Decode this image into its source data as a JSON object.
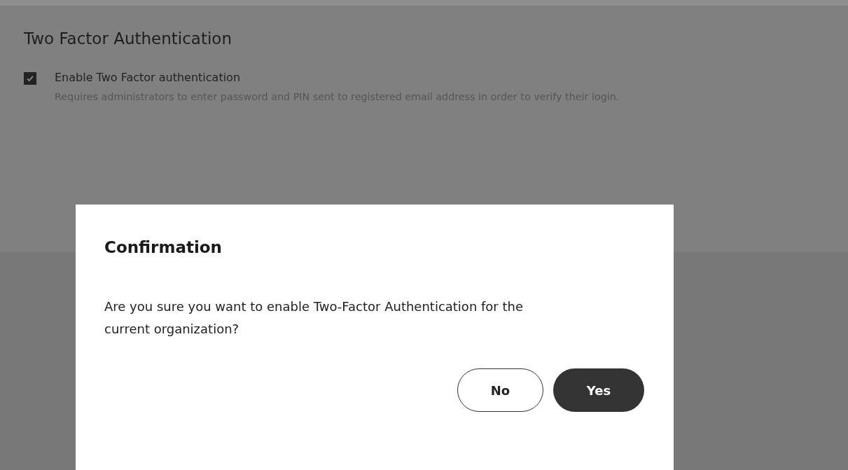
{
  "page": {
    "title": "Two Factor Authentication",
    "option": {
      "label": "Enable Two Factor authentication",
      "checked": true,
      "description": "Requires administrators to enter password and PIN sent to registered email address in order to verify their login."
    }
  },
  "dialog": {
    "title": "Confirmation",
    "message": "Are you sure you want to enable Two-Factor Authentication for the current organization?",
    "buttons": [
      {
        "label": "No",
        "kind": "secondary"
      },
      {
        "label": "Yes",
        "kind": "primary"
      }
    ]
  }
}
